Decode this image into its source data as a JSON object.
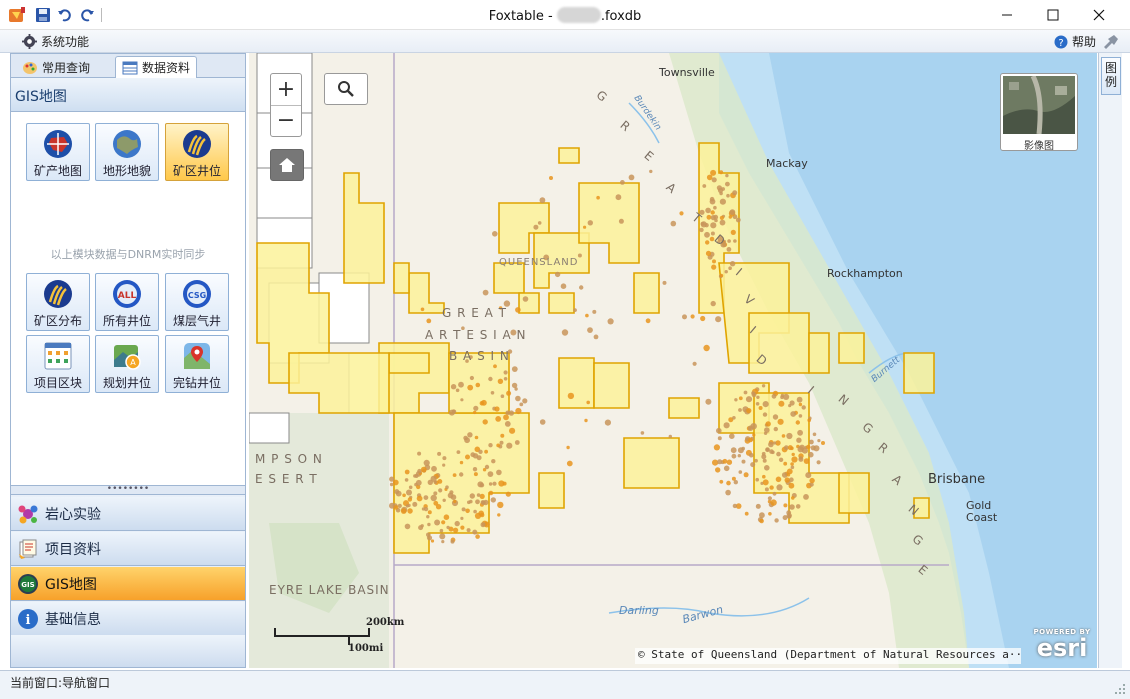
{
  "window": {
    "title_prefix": "Foxtable - ",
    "title_suffix": ".foxdb",
    "minimize_icon": "minimize-icon",
    "maximize_icon": "maximize-icon",
    "close_icon": "close-icon"
  },
  "menubar": {
    "system_label": "系统功能",
    "help_label": "帮助"
  },
  "left_panel": {
    "tabs": [
      {
        "label": "常用查询",
        "active": false
      },
      {
        "label": "数据资料",
        "active": true
      }
    ],
    "group_title": "GIS地图",
    "tiles_row1": [
      {
        "label": "矿产地图",
        "icon": "australia-globe-icon",
        "selected": false
      },
      {
        "label": "地形地貌",
        "icon": "earth-globe-icon",
        "selected": false
      },
      {
        "label": "矿区井位",
        "icon": "mining-area-icon",
        "selected": true
      }
    ],
    "sync_note": "以上模块数据与DNRM实时同步",
    "tiles_row2": [
      {
        "label": "矿区分布",
        "icon": "mining-area-icon",
        "selected": false
      },
      {
        "label": "所有井位",
        "icon": "all-wells-icon",
        "badge": "ALL",
        "selected": false
      },
      {
        "label": "煤层气井",
        "icon": "csg-wells-icon",
        "badge": "CSG",
        "selected": false
      }
    ],
    "tiles_row3": [
      {
        "label": "项目区块",
        "icon": "grid-blocks-icon",
        "selected": false
      },
      {
        "label": "规划井位",
        "icon": "planned-wells-icon",
        "selected": false
      },
      {
        "label": "完钻井位",
        "icon": "completed-wells-icon",
        "selected": false
      }
    ],
    "nav": [
      {
        "label": "岩心实验",
        "icon": "molecule-icon",
        "active": false
      },
      {
        "label": "项目资料",
        "icon": "documents-icon",
        "active": false
      },
      {
        "label": "GIS地图",
        "icon": "gis-icon",
        "badge": "GIS",
        "active": true
      },
      {
        "label": "基础信息",
        "icon": "info-icon",
        "badge": "i",
        "active": false
      }
    ]
  },
  "map": {
    "zoom_in": "+",
    "zoom_out": "−",
    "basemap_label": "影像图",
    "scale_km": "200km",
    "scale_mi": "100mi",
    "attribution": "© State of Queensland (Department of Natural Resources a···",
    "esri_powered": "POWERED BY",
    "esri_brand": "esri",
    "cities": {
      "townsville": "Townsville",
      "mackay": "Mackay",
      "rockhampton": "Rockhampton",
      "brisbane": "Brisbane",
      "gold": "Gold",
      "coast": "Coast"
    },
    "regions": {
      "great": "G R E A T",
      "artesian": "A R T E S I A N",
      "basin": "B A S I N",
      "queensland": "QUEENSLAND",
      "simpson": "M P S O N",
      "desert": "E S E R T",
      "eyre": "EYRE LAKE BASIN"
    },
    "rivers": {
      "burdekin": "Burdekin",
      "burnett": "Burnett",
      "darling": "Darling",
      "barwon": "Barwon"
    },
    "range_letters": [
      "G",
      "R",
      "E",
      "A",
      "T",
      "D",
      "I",
      "V",
      "I",
      "D",
      "I",
      "N",
      "G",
      "R",
      "A",
      "N",
      "G",
      "E"
    ]
  },
  "legend_tab": "图例",
  "status": {
    "text": "当前窗口:导航窗口"
  },
  "colors": {
    "accent_orange": "#f7a12a",
    "lease_fill": "#fbf29a",
    "lease_stroke": "#e0a400",
    "well_dot": "#c8955a",
    "water": "#a9d3f0"
  }
}
